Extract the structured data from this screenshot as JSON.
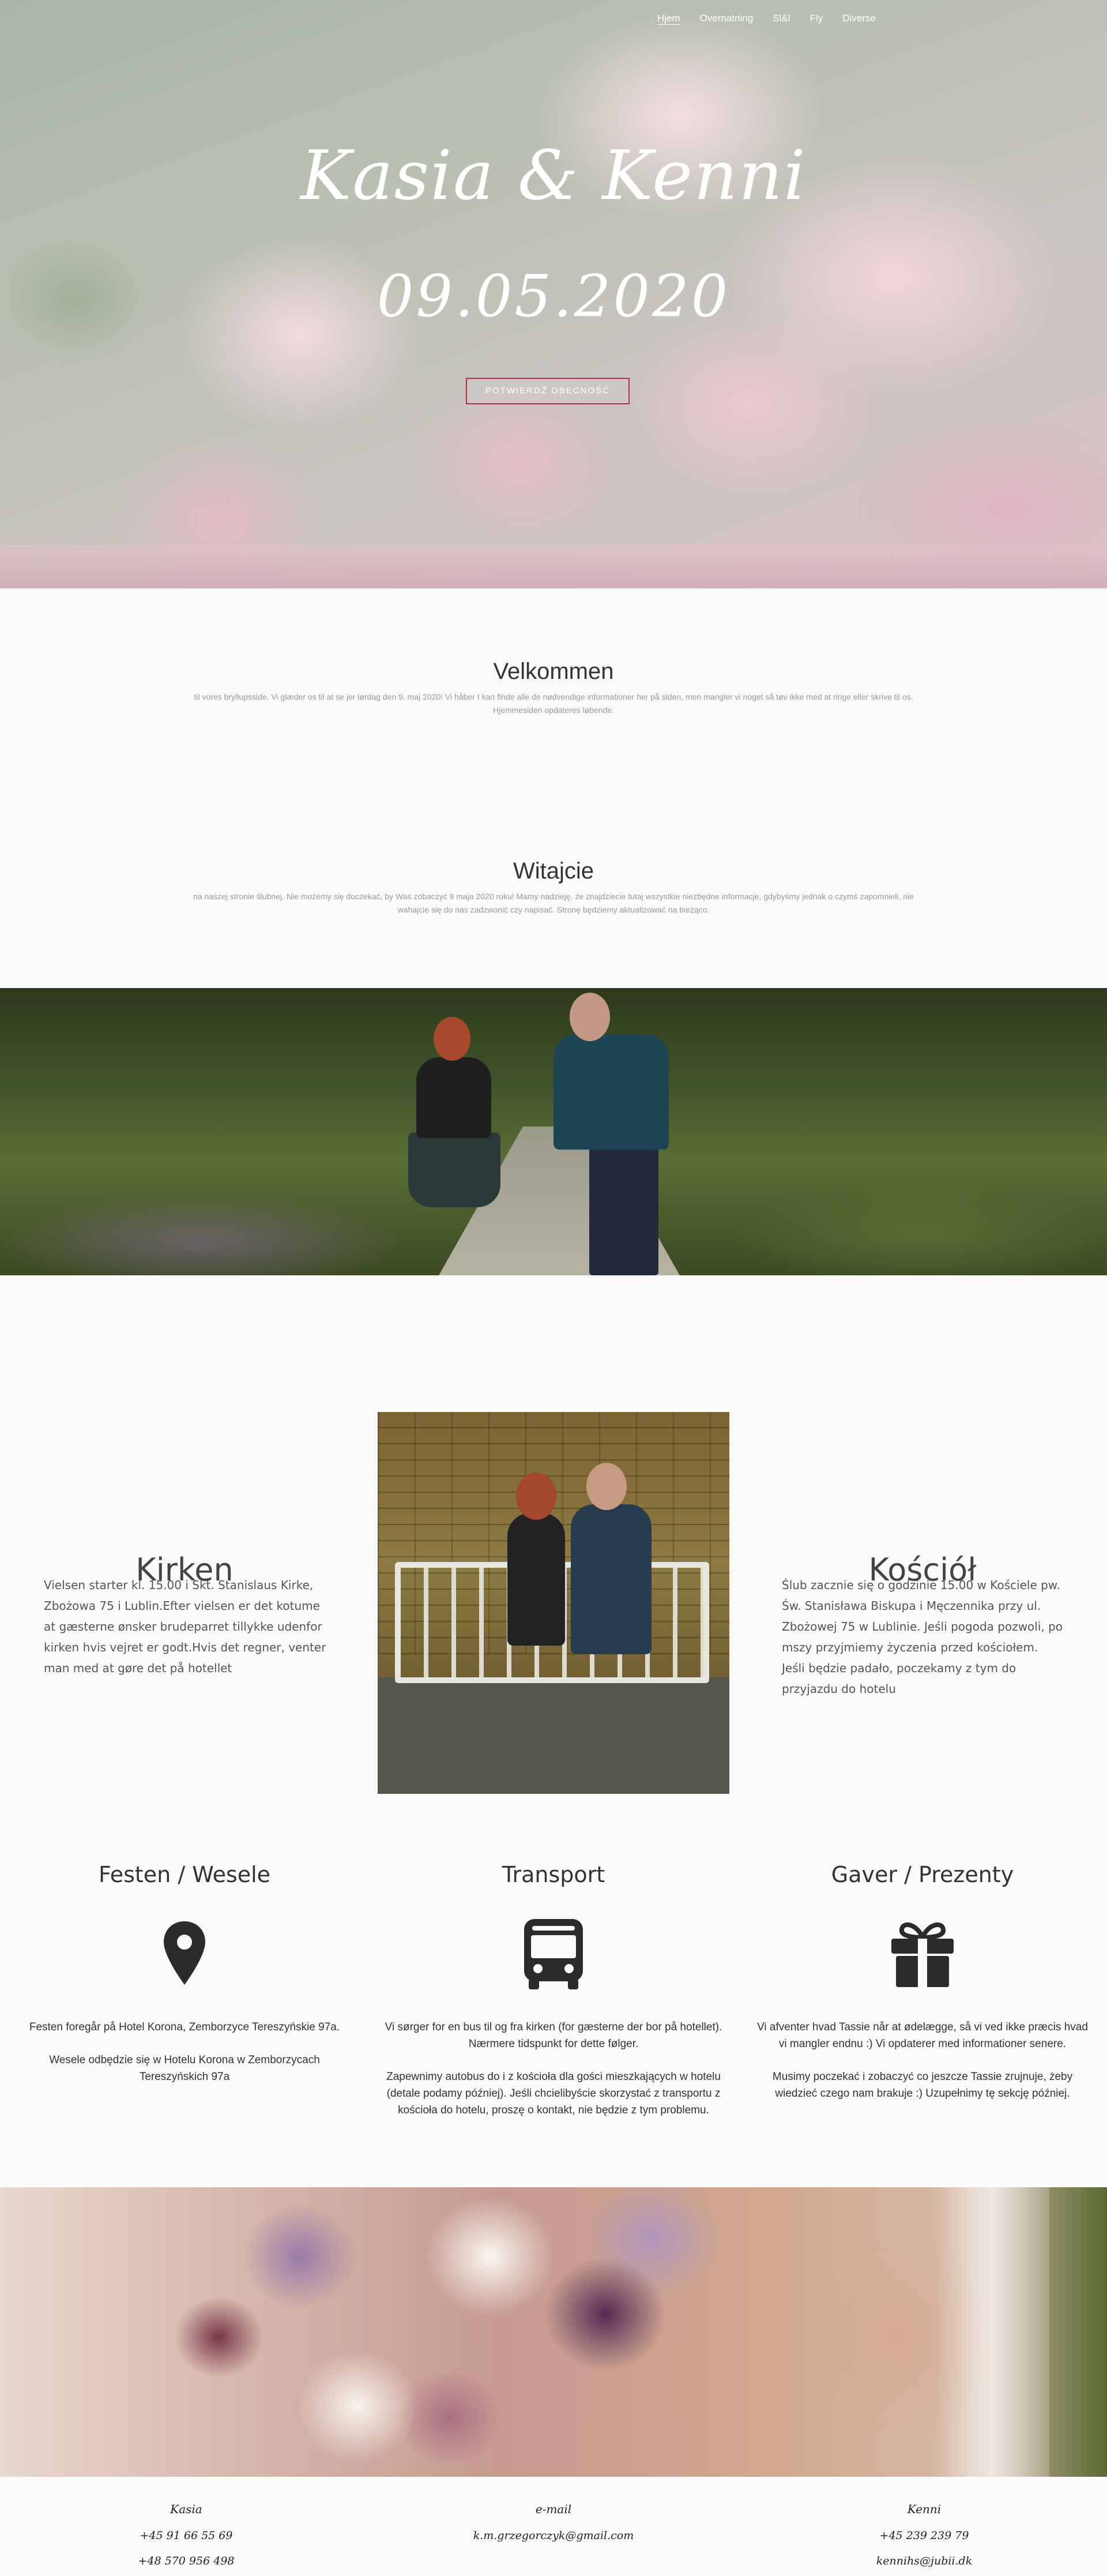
{
  "nav": {
    "items": [
      {
        "label": "Hjem"
      },
      {
        "label": "Overnatning"
      },
      {
        "label": "Sl&l"
      },
      {
        "label": "Fly"
      },
      {
        "label": "Diverse"
      }
    ]
  },
  "hero": {
    "names": "Kasia & Kenni",
    "date": "09.05.2020",
    "button_label": "Potwierdź obecność"
  },
  "welcome_da": {
    "title": "Velkommen",
    "text": "til vores bryllupsside. Vi glæder os til at se jer lørdag den 9. maj 2020! Vi håber I kan finde alle de nødvendige informationer her på siden, men mangler vi noget så tøv ikke med at ringe eller skrive til os. Hjemmesiden opdateres løbende."
  },
  "welcome_pl": {
    "title": "Witajcie",
    "text": "na naszej stronie ślubnej. Nie możemy się doczekać, by Was zobaczyć 9 maja 2020 roku! Mamy nadzieję, że znajdziecie tutaj wszystkie niezbędne informacje, gdybyśmy jednak o czymś zapomnieli, nie wahajcie się do nas zadzwonić czy napisać. Stronę będziemy aktualizować na bieżąco."
  },
  "church": {
    "da": {
      "title": "Kirken",
      "text": "Vielsen starter kl. 15.00 i Skt. Stanislaus Kirke, Zbożowa 75 i Lublin.Efter vielsen er det kotume at gæsterne ønsker brudeparret tillykke udenfor kirken hvis vejret er godt.Hvis det regner, venter man med at gøre det på hotellet"
    },
    "pl": {
      "title": "Kościół",
      "text": "Ślub zacznie się o godzinie 15.00 w Kościele pw. Św. Stanisława Biskupa i Męczennika przy ul. Zbożowej 75 w Lublinie. Jeśli pogoda pozwoli, po mszy przyjmiemy życzenia przed kościołem. Jeśli będzie padało, poczekamy z tym do przyjazdu do hotelu"
    }
  },
  "info": [
    {
      "title": "Festen / Wesele",
      "icon": "map-pin-icon",
      "paragraphs": [
        "Festen foregår på Hotel Korona, Zemborzyce Tereszyńskie 97a.",
        "Wesele odbędzie się w Hotelu Korona w Zemborzycach Tereszyńskich 97a"
      ]
    },
    {
      "title": "Transport",
      "icon": "bus-icon",
      "paragraphs": [
        "Vi sørger for en bus til og fra kirken (for gæsterne der bor på hotellet). Nærmere tidspunkt for dette følger.",
        "Zapewnimy autobus do i z kościoła dla gości mieszkających w hotelu (detale podamy później). Jeśli chcielibyście skorzystać z transportu z kościoła do hotelu, proszę o kontakt, nie będzie z tym problemu."
      ]
    },
    {
      "title": "Gaver / Prezenty",
      "icon": "gift-icon",
      "paragraphs": [
        "Vi afventer hvad Tassie når at ødelægge, så vi ved ikke præcis hvad vi mangler endnu :) Vi opdaterer med informationer senere.",
        "Musimy poczekać i zobaczyć co jeszcze Tassie zrujnuje, żeby wiedzieć czego nam brakuje :) Uzupełnimy tę sekcję później."
      ]
    }
  ],
  "contacts": [
    {
      "name": "Kasia",
      "lines": [
        "+45 91 66 55 69",
        "+48 570 956 498"
      ]
    },
    {
      "name": "e-mail",
      "lines": [
        "k.m.grzegorczyk@gmail.com"
      ]
    },
    {
      "name": "Kenni",
      "lines": [
        "+45 239 239 79",
        "kennihs@jubii.dk"
      ]
    }
  ]
}
